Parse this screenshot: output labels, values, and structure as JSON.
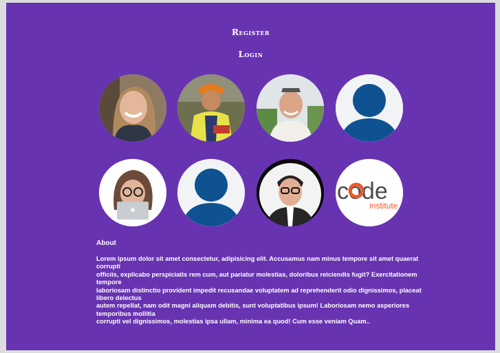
{
  "nav": {
    "register": "Register",
    "login": "Login"
  },
  "avatars": [
    {
      "icon": "woman-smiling-photo"
    },
    {
      "icon": "man-outdoors-photo"
    },
    {
      "icon": "man-with-sunglasses-photo"
    },
    {
      "icon": "default-user-icon"
    },
    {
      "icon": "memoji-laptop-avatar"
    },
    {
      "icon": "default-user-icon"
    },
    {
      "icon": "man-with-glasses-photo"
    },
    {
      "icon": "code-institute-logo",
      "logo_text": "code",
      "logo_sub": "institute"
    }
  ],
  "about": {
    "title": "About",
    "lines": [
      "Lorem ipsum dolor sit amet consectetur, adipisicing elit. Accusamus nam minus tempore sit amet quaerat corrupti",
      "officiis, explicabo perspiciatis rem cum, aut pariatur molestias, doloribus reiciendis fugit? Exercitationem tempore",
      "laboriosam distinctio provident impedit recusandae voluptatem ad reprehenderit odio dignissimos, placeat libero delectus",
      "autem repellat, nam odit magni aliquam debitis, sunt voluptatibus ipsum! Laboriosam nemo asperiores temporibus mollitia",
      "corrupti vel dignissimos, molestias ipsa ullam, minima ea quod! Cum esse veniam  Quam.."
    ]
  },
  "colors": {
    "page_bg": "#6833b1",
    "placeholder_blue": "#0f5291",
    "code_orange": "#e9592b",
    "code_gray": "#4c4c4c"
  }
}
